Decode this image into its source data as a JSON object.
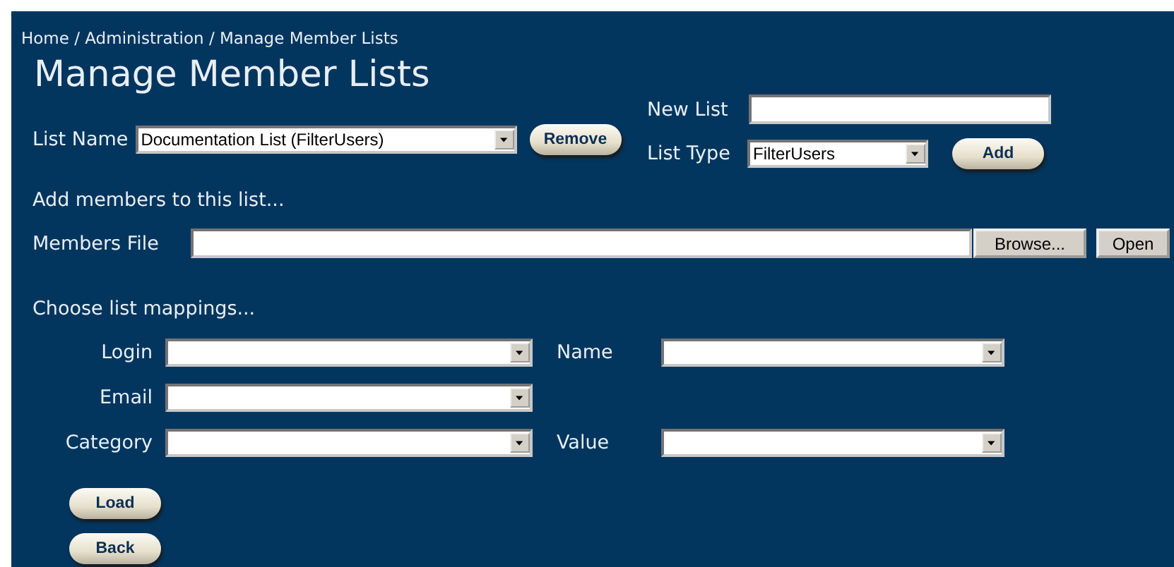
{
  "breadcrumb": "Home / Administration / Manage Member Lists",
  "title": "Manage Member Lists",
  "list_name": {
    "label": "List Name",
    "value": "Documentation List (FilterUsers)"
  },
  "remove_button": "Remove",
  "new_list": {
    "label": "New List"
  },
  "list_type": {
    "label": "List Type",
    "value": "FilterUsers"
  },
  "add_button": "Add",
  "add_members_heading": "Add members to this list...",
  "members_file": {
    "label": "Members File"
  },
  "browse_button": "Browse...",
  "open_button": "Open",
  "mappings_heading": "Choose list mappings...",
  "mapping_rows": [
    [
      {
        "label": "Login"
      },
      {
        "label": "Name"
      }
    ],
    [
      {
        "label": "Email"
      }
    ],
    [
      {
        "label": "Category"
      },
      {
        "label": "Value"
      }
    ]
  ],
  "action_buttons": [
    "Load",
    "Back"
  ]
}
